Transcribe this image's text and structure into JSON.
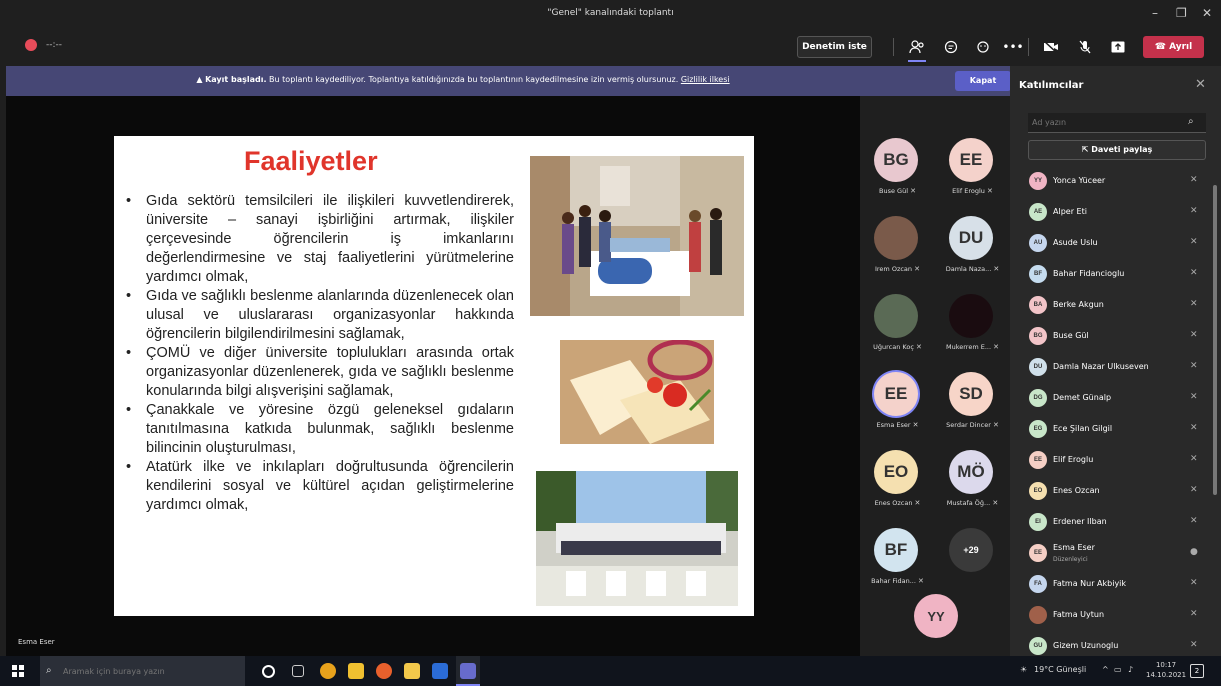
{
  "window": {
    "title": "\"Genel\" kanalındaki toplantı",
    "minimize": "–",
    "maximize": "❐",
    "close": "✕"
  },
  "toolbar": {
    "timer": "--:--",
    "denetim": "Denetim iste",
    "leave": "Ayrıl"
  },
  "banner": {
    "bold": "Kayıt başladı.",
    "text": " Bu toplantı kaydediliyor. Toplantıya katıldığınızda bu toplantının kaydedilmesine izin vermiş olursunuz. ",
    "link": "Gizlilik ilkesi",
    "close": "Kapat"
  },
  "slide": {
    "title": "Faaliyetler",
    "bullets": [
      "Gıda sektörü temsilcileri ile ilişkileri kuvvetlendirerek, üniversite – sanayi işbirliğini artırmak, ilişkiler çerçevesinde öğrencilerin iş imkanlarını değerlendirmesine ve staj faaliyetlerini yürütmelerine yardımcı olmak,",
      "Gıda ve sağlıklı beslenme alanlarında düzenlenecek olan ulusal ve uluslararası organizasyonlar hakkında öğrencilerin bilgilendirilmesini sağlamak,",
      "ÇOMÜ ve diğer üniversite toplulukları arasında ortak organizasyonlar düzenlenerek, gıda ve sağlıklı beslenme konularında bilgi alışverişini sağlamak,",
      "Çanakkale ve yöresine özgü geleneksel gıdaların tanıtılmasına katkıda bulunmak, sağlıklı beslenme bilincinin oluşturulması,",
      "Atatürk ilke ve inkılapları doğrultusunda öğrencilerin kendilerini sosyal ve kültürel açıdan geliştirmelerine yardımcı olmak,"
    ],
    "bullet_char": "•"
  },
  "speaker": "Esma Eser",
  "gallery": [
    {
      "initials": "BG",
      "name": "Buse Gül",
      "color": "#e8c8cf"
    },
    {
      "initials": "EE",
      "name": "Elif Eroglu",
      "color": "#f4d2cb"
    },
    {
      "initials": "",
      "name": "Irem Ozcan",
      "color": "#7a5a4a"
    },
    {
      "initials": "DU",
      "name": "Damla Naza...",
      "color": "#d7e0e8"
    },
    {
      "initials": "",
      "name": "Uğurcan Koç",
      "color": "#5a6a55"
    },
    {
      "initials": "",
      "name": "Mukerrem E...",
      "color": "#1a0c10"
    },
    {
      "initials": "EE",
      "name": "Esma Eser",
      "color": "#f4d2cb"
    },
    {
      "initials": "SD",
      "name": "Serdar Dincer",
      "color": "#f7d5c8"
    },
    {
      "initials": "EO",
      "name": "Enes Ozcan",
      "color": "#f5e0b0"
    },
    {
      "initials": "MÖ",
      "name": "Mustafa Öğ...",
      "color": "#dcd9ec"
    },
    {
      "initials": "BF",
      "name": "Bahar Fidan...",
      "color": "#d2e4ef"
    },
    {
      "initials": "+29",
      "name": "",
      "color": "#3a3a3a"
    }
  ],
  "self_tile": {
    "initials": "YY"
  },
  "panel": {
    "title": "Katılımcılar",
    "search_placeholder": "Ad yazın",
    "share": "Daveti paylaş",
    "participants": [
      {
        "initials": "YY",
        "name": "Yonca Yüceer",
        "role": "",
        "color": "#f0b4c4"
      },
      {
        "initials": "AE",
        "name": "Alper Eti",
        "role": "",
        "color": "#c8e6c9"
      },
      {
        "initials": "AU",
        "name": "Asude Uslu",
        "role": "",
        "color": "#c5d6ee"
      },
      {
        "initials": "BF",
        "name": "Bahar Fidancioglu",
        "role": "",
        "color": "#c5dcef"
      },
      {
        "initials": "BA",
        "name": "Berke Akgun",
        "role": "",
        "color": "#f2c4c8"
      },
      {
        "initials": "BG",
        "name": "Buse Gül",
        "role": "",
        "color": "#f2c4c8"
      },
      {
        "initials": "DU",
        "name": "Damla Nazar Ulkuseven",
        "role": "",
        "color": "#d0e0ea"
      },
      {
        "initials": "DG",
        "name": "Demet Günalp",
        "role": "",
        "color": "#c8e6c9"
      },
      {
        "initials": "EG",
        "name": "Ece Şilan Gilgil",
        "role": "",
        "color": "#c8e6c9"
      },
      {
        "initials": "EE",
        "name": "Elif Eroglu",
        "role": "",
        "color": "#f5cfc5"
      },
      {
        "initials": "EO",
        "name": "Enes Ozcan",
        "role": "",
        "color": "#f5e0b0"
      },
      {
        "initials": "EI",
        "name": "Erdener Ilban",
        "role": "",
        "color": "#c8e6c9"
      },
      {
        "initials": "EE",
        "name": "Esma Eser",
        "role": "Düzenleyici",
        "color": "#f5cfc5"
      },
      {
        "initials": "FA",
        "name": "Fatma Nur Akbiyik",
        "role": "",
        "color": "#c5d6ee"
      },
      {
        "initials": "",
        "name": "Fatma Uytun",
        "role": "",
        "color": "#a0604a"
      },
      {
        "initials": "GU",
        "name": "Gizem Uzunoglu",
        "role": "",
        "color": "#c8e6c9"
      }
    ]
  },
  "taskbar": {
    "search_placeholder": "Aramak için buraya yazın",
    "weather": "19°C Güneşli",
    "time": "10:17",
    "date": "14.10.2021",
    "notif": "2"
  }
}
